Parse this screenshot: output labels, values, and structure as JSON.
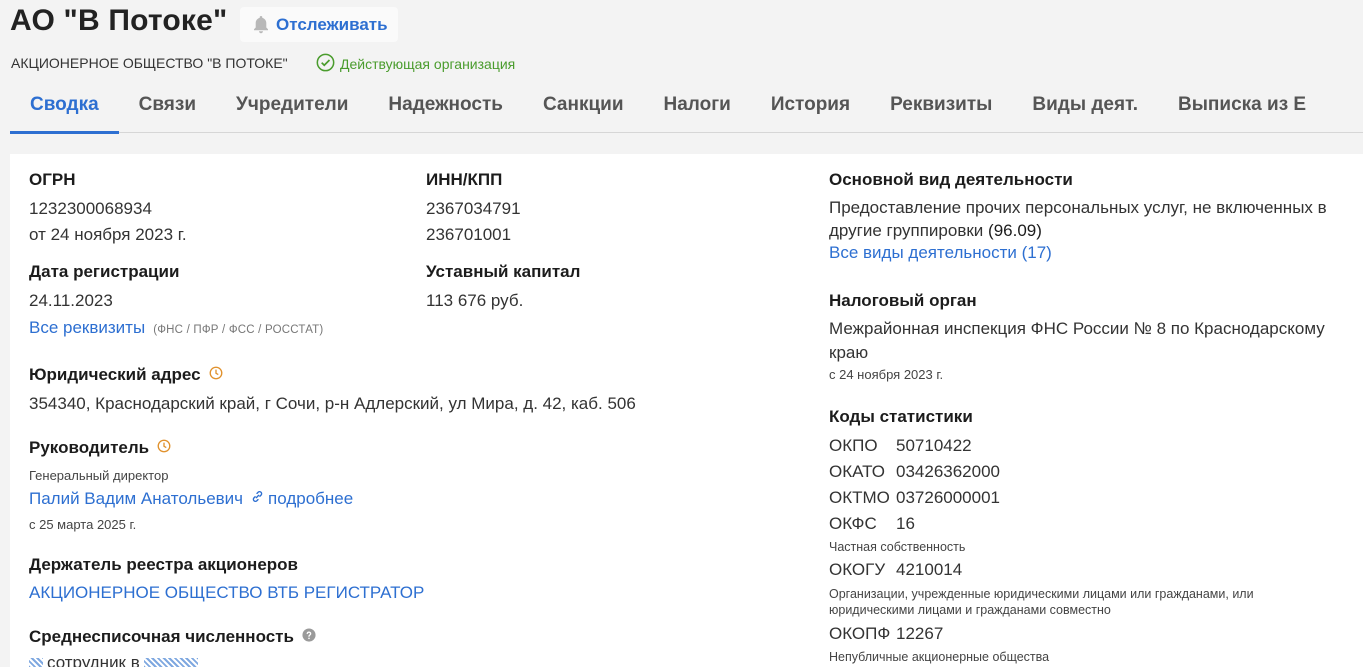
{
  "header": {
    "title": "АО \"В Потоке\"",
    "track_label": "Отслеживать",
    "full_name": "АКЦИОНЕРНОЕ ОБЩЕСТВО \"В ПОТОКЕ\"",
    "status": "Действующая организация"
  },
  "tabs": [
    {
      "label": "Сводка",
      "active": true
    },
    {
      "label": "Связи"
    },
    {
      "label": "Учредители"
    },
    {
      "label": "Надежность"
    },
    {
      "label": "Санкции"
    },
    {
      "label": "Налоги"
    },
    {
      "label": "История"
    },
    {
      "label": "Реквизиты"
    },
    {
      "label": "Виды деят."
    },
    {
      "label": "Выписка из Е"
    }
  ],
  "left": {
    "ogrn_label": "ОГРН",
    "ogrn_value": "1232300068934",
    "ogrn_date": "от 24 ноября 2023 г.",
    "inn_label": "ИНН/КПП",
    "inn_value": "2367034791",
    "kpp_value": "236701001",
    "reg_date_label": "Дата регистрации",
    "reg_date_value": "24.11.2023",
    "capital_label": "Уставный капитал",
    "capital_value": "113 676 руб.",
    "all_details_link": "Все реквизиты",
    "all_details_note": "(ФНС / ПФР / ФСС / РОССТАТ)",
    "address_label": "Юридический адрес",
    "address_value": "354340, Краснодарский край, г Сочи, р-н Адлерский, ул Мира, д. 42, каб. 506",
    "head_label": "Руководитель",
    "head_position": "Генеральный директор",
    "head_name": "Палий Вадим Анатольевич",
    "head_more": "подробнее",
    "head_since": "с 25 марта 2025 г.",
    "registry_label": "Держатель реестра акционеров",
    "registry_value": "АКЦИОНЕРНОЕ ОБЩЕСТВО ВТБ РЕГИСТРАТОР",
    "employees_label": "Среднесписочная численность",
    "employees_value": "сотрудник в"
  },
  "right": {
    "activity_label": "Основной вид деятельности",
    "activity_value": "Предоставление прочих персональных услуг, не включенных в другие группировки",
    "activity_code": "(96.09)",
    "activity_link": "Все виды деятельности (17)",
    "tax_label": "Налоговый орган",
    "tax_value": "Межрайонная инспекция ФНС России № 8 по Краснодарскому краю",
    "tax_since": "с 24 ноября 2023 г.",
    "codes_label": "Коды статистики",
    "codes": [
      {
        "k": "ОКПО",
        "v": "50710422",
        "note": ""
      },
      {
        "k": "ОКАТО",
        "v": "03426362000",
        "note": ""
      },
      {
        "k": "ОКТМО",
        "v": "03726000001",
        "note": ""
      },
      {
        "k": "ОКФС",
        "v": "16",
        "note": "Частная собственность"
      },
      {
        "k": "ОКОГУ",
        "v": "4210014",
        "note": "Организации, учрежденные юридическими лицами или гражданами, или юридическими лицами и гражданами совместно"
      },
      {
        "k": "ОКОПФ",
        "v": "12267",
        "note": "Непубличные акционерные общества"
      }
    ]
  },
  "colors": {
    "accent": "#2d6fd1",
    "status": "#4a9c2d",
    "clock": "#e0902a"
  }
}
